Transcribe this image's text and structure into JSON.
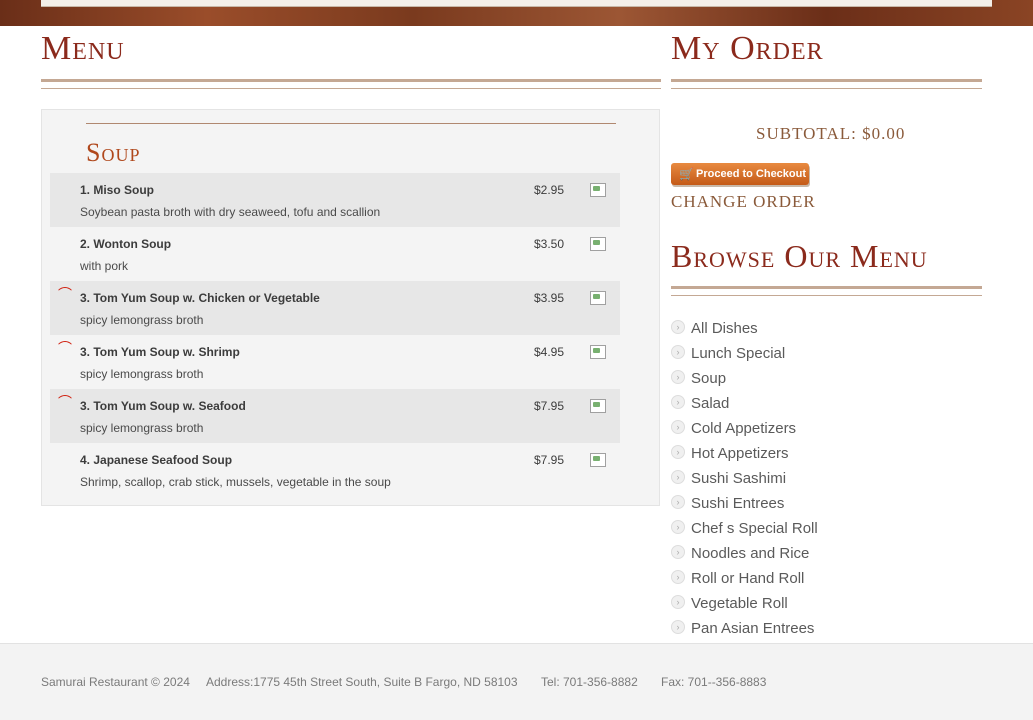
{
  "menu": {
    "title": "Menu",
    "section_title": "Soup",
    "items": [
      {
        "name": "1. Miso Soup",
        "desc": "Soybean pasta broth with dry seaweed, tofu and scallion",
        "price": "$2.95",
        "spicy": false
      },
      {
        "name": "2. Wonton Soup",
        "desc": "with pork",
        "price": "$3.50",
        "spicy": false
      },
      {
        "name": "3. Tom Yum Soup w. Chicken or Vegetable",
        "desc": "spicy lemongrass broth",
        "price": "$3.95",
        "spicy": true
      },
      {
        "name": "3. Tom Yum Soup w. Shrimp",
        "desc": "spicy lemongrass broth",
        "price": "$4.95",
        "spicy": true
      },
      {
        "name": "3. Tom Yum Soup w. Seafood",
        "desc": "spicy lemongrass broth",
        "price": "$7.95",
        "spicy": true
      },
      {
        "name": "4. Japanese Seafood Soup",
        "desc": "Shrimp, scallop, crab stick, mussels, vegetable in the soup",
        "price": "$7.95",
        "spicy": false
      }
    ]
  },
  "order": {
    "title": "My Order",
    "subtotal": "SUBTOTAL: $0.00",
    "checkout_label": "Proceed to Checkout",
    "change_label": "CHANGE ORDER"
  },
  "browse": {
    "title": "Browse Our Menu",
    "categories": [
      "All Dishes",
      "Lunch Special",
      "Soup",
      "Salad",
      "Cold Appetizers",
      "Hot Appetizers",
      "Sushi Sashimi",
      "Sushi Entrees",
      "Chef s Special Roll",
      "Noodles and Rice",
      "Roll or Hand Roll",
      "Vegetable Roll",
      "Pan Asian Entrees"
    ]
  },
  "footer": {
    "copyright": "Samurai Restaurant © 2024",
    "address": "Address:1775 45th Street South, Suite B Fargo, ND 58103",
    "tel": "Tel: 701-356-8882",
    "fax": "Fax: 701--356-8883"
  },
  "icons": {
    "spicy": "chili-pepper-icon",
    "add": "add-to-order-icon",
    "cart": "cart-icon",
    "bullet": "chevron-right-icon"
  },
  "colors": {
    "heading": "#8b2a1c",
    "accent": "#c45a18"
  }
}
